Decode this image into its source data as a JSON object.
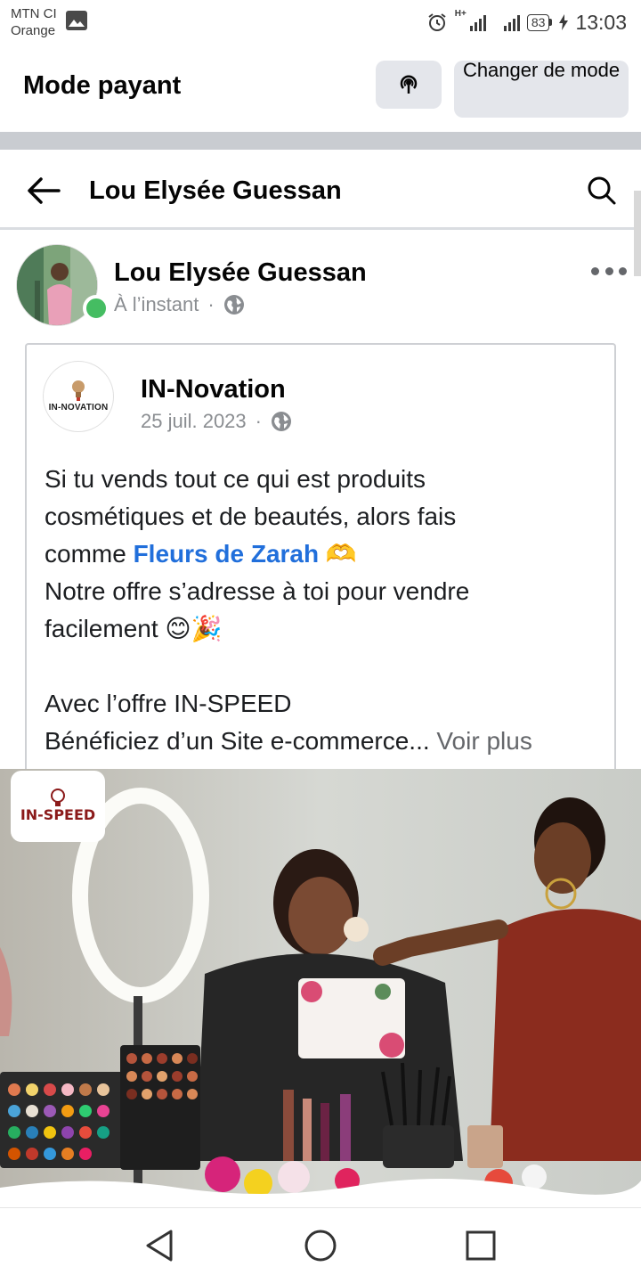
{
  "status_bar": {
    "carrier_line1": "MTN CI",
    "carrier_line2": "Orange",
    "network_type": "H+",
    "battery": "83",
    "time": "13:03"
  },
  "mode_bar": {
    "title": "Mode payant",
    "change_mode_label": "Changer de mode"
  },
  "header": {
    "title": "Lou Elysée Guessan"
  },
  "post": {
    "author": "Lou Elysée Guessan",
    "time": "À l’instant",
    "shared": {
      "page_name": "IN-Novation",
      "page_logo": "IN-NOVATION",
      "date": "25 juil. 2023",
      "text_line1": "Si tu vends tout ce qui est produits",
      "text_line2": "cosmétiques et de beautés, alors fais",
      "text_line3_prefix": "comme ",
      "mention": "Fleurs de Zarah",
      "text_line3_suffix": " 🫶",
      "text_line4": "Notre offre s’adresse à toi pour vendre",
      "text_line5": "facilement 😊🎉",
      "text_line6": "Avec l’offre IN-SPEED",
      "text_line7": "Bénéficiez d’un Site e-commerce...",
      "see_more": "Voir plus"
    },
    "image_badge": "IN-SPEED"
  },
  "colors": {
    "accent_link": "#216fdb",
    "online": "#45bd62",
    "button_bg": "#e4e6eb"
  }
}
